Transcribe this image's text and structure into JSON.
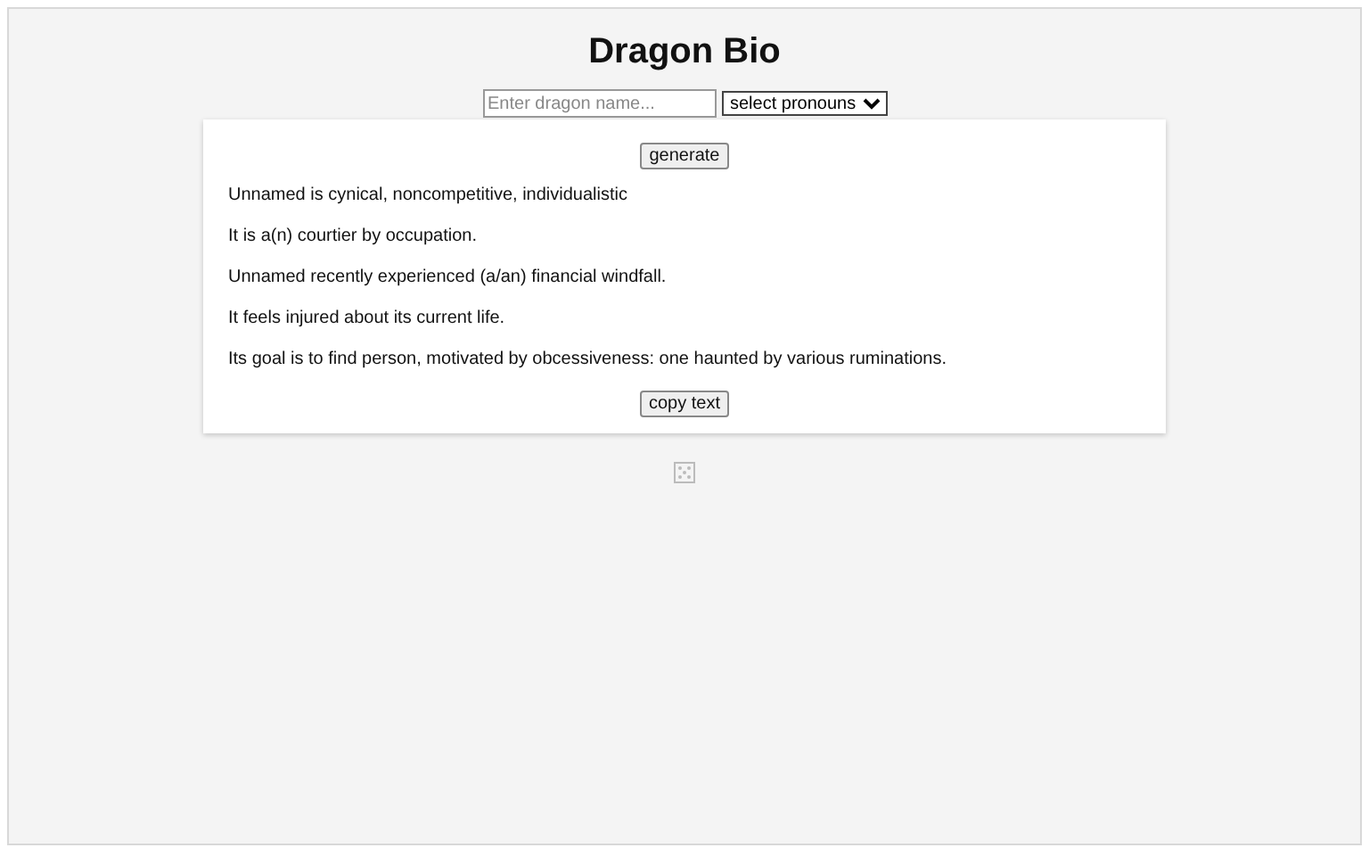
{
  "title": "Dragon Bio",
  "name_field": {
    "placeholder": "Enter dragon name..."
  },
  "pronoun_select": {
    "value": "select pronouns"
  },
  "generate_button": "generate",
  "bio_lines": [
    "Unnamed is cynical, noncompetitive, individualistic",
    "It is a(n) courtier by occupation.",
    "Unnamed recently experienced (a/an) financial windfall.",
    "It feels injured about its current life.",
    "Its goal is to find person, motivated by obcessiveness: one haunted by various ruminations."
  ],
  "copy_button": "copy text"
}
